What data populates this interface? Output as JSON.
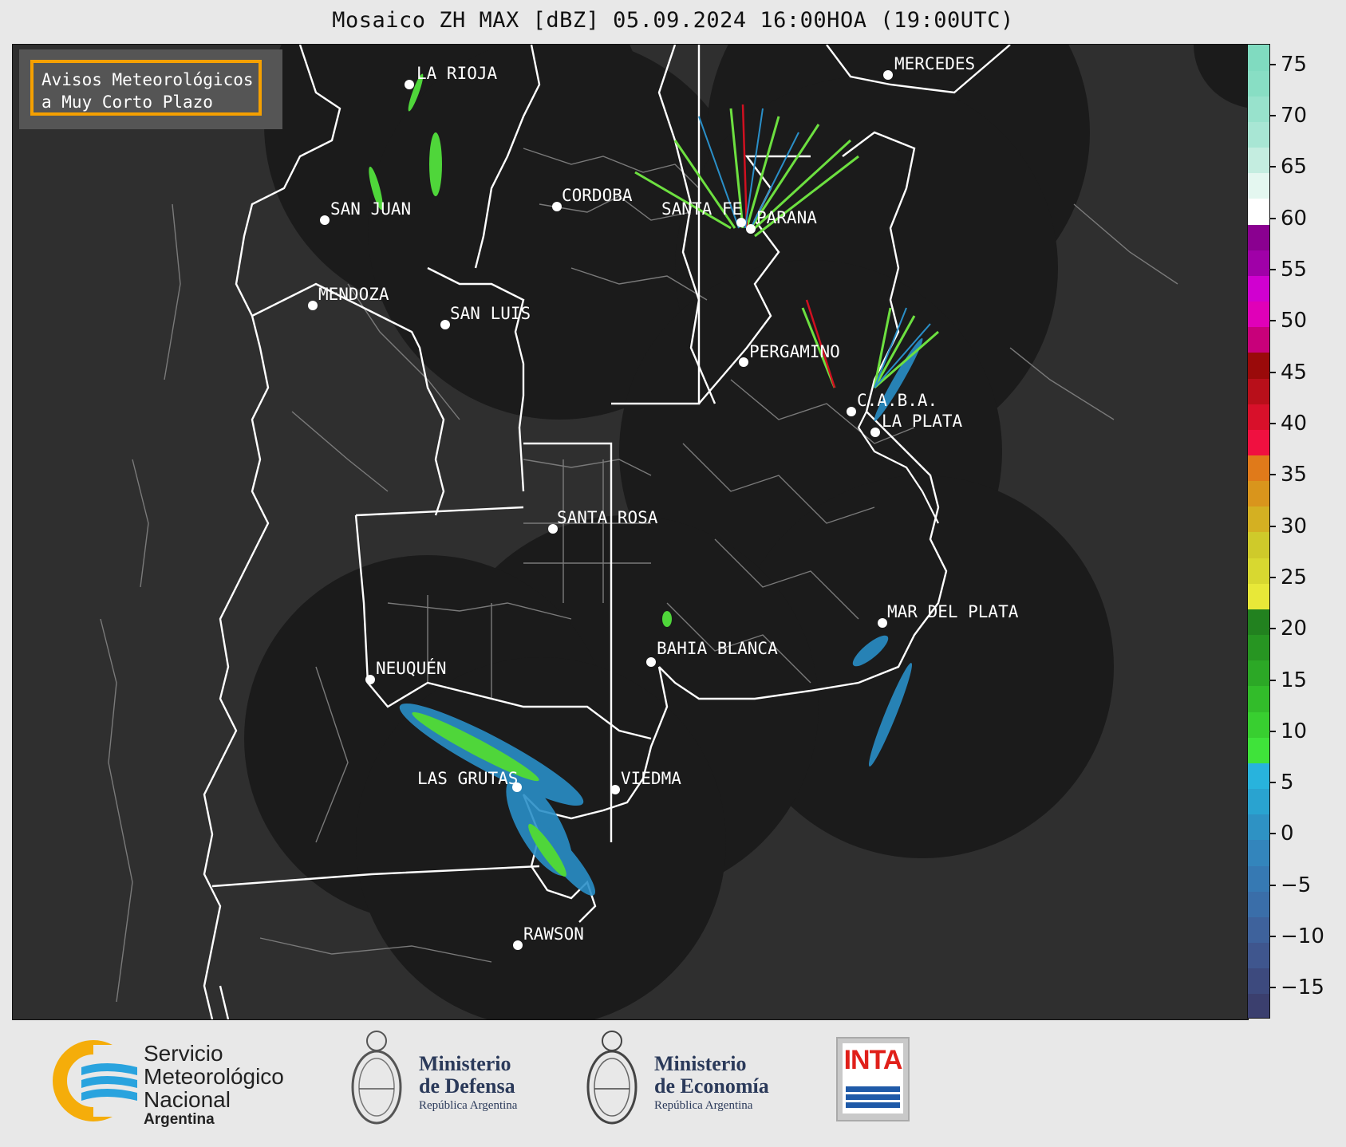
{
  "title": "Mosaico ZH MAX [dBZ] 05.09.2024 16:00HOA (19:00UTC)",
  "notice": {
    "line1": "Avisos Meteorológicos",
    "line2": "a Muy Corto Plazo"
  },
  "cities": [
    {
      "name": "LA RIOJA"
    },
    {
      "name": "MERCEDES"
    },
    {
      "name": "CORDOBA"
    },
    {
      "name": "SAN JUAN"
    },
    {
      "name": "SANTA FE"
    },
    {
      "name": "PARANA"
    },
    {
      "name": "MENDOZA"
    },
    {
      "name": "SAN LUIS"
    },
    {
      "name": "PERGAMINO"
    },
    {
      "name": "C.A.B.A."
    },
    {
      "name": "LA PLATA"
    },
    {
      "name": "SANTA ROSA"
    },
    {
      "name": "MAR DEL PLATA"
    },
    {
      "name": "BAHIA BLANCA"
    },
    {
      "name": "NEUQUÉN"
    },
    {
      "name": "LAS GRUTAS"
    },
    {
      "name": "VIEDMA"
    },
    {
      "name": "RAWSON"
    }
  ],
  "colorbar": {
    "ticks": [
      "75",
      "70",
      "65",
      "60",
      "55",
      "50",
      "45",
      "40",
      "35",
      "30",
      "25",
      "20",
      "15",
      "10",
      "5",
      "0",
      "−5",
      "−10",
      "−15"
    ],
    "colors": [
      "#3b3f6e",
      "#3d4a7e",
      "#3f568e",
      "#3e629c",
      "#3a6ea9",
      "#3679b3",
      "#3385bc",
      "#2e92c4",
      "#29a3d0",
      "#28b3dd",
      "#3fe33a",
      "#38cf30",
      "#32bc2a",
      "#2ca826",
      "#279522",
      "#22811f",
      "#e8e838",
      "#d8d830",
      "#cfca2a",
      "#d4b022",
      "#d9951c",
      "#e07a1a",
      "#f01040",
      "#d8102a",
      "#b80f1a",
      "#9a0a0a",
      "#c8007a",
      "#e000b8",
      "#d000d0",
      "#a000a8",
      "#8a0090",
      "#ffffff",
      "#e4f7f0",
      "#c4ede0",
      "#a8e6d4",
      "#98e2cc",
      "#88dec4",
      "#80dbc0"
    ],
    "range": [
      -18,
      77
    ]
  },
  "footer": {
    "smn": {
      "l1": "Servicio",
      "l2": "Meteorológico",
      "l3": "Nacional",
      "l4": "Argentina"
    },
    "defensa": {
      "l1": "Ministerio",
      "l2": "de Defensa",
      "l3": "República Argentina"
    },
    "economia": {
      "l1": "Ministerio",
      "l2": "de Economía",
      "l3": "República Argentina"
    },
    "inta": {
      "text": "INTA"
    }
  }
}
